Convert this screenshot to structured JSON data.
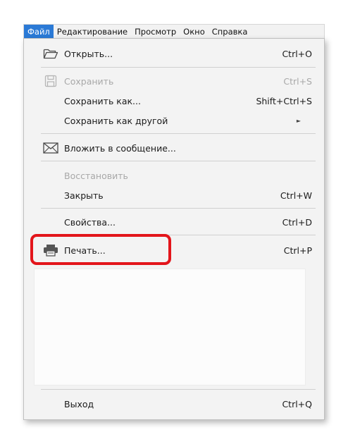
{
  "menubar": {
    "items": [
      "Файл",
      "Редактирование",
      "Просмотр",
      "Окно",
      "Справка"
    ]
  },
  "file_menu": {
    "open": {
      "label": "Открыть...",
      "shortcut": "Ctrl+O",
      "icon": "folder-open-icon"
    },
    "save": {
      "label": "Сохранить",
      "shortcut": "Ctrl+S",
      "icon": "save-icon",
      "disabled": true
    },
    "save_as": {
      "label": "Сохранить как...",
      "shortcut": "Shift+Ctrl+S"
    },
    "save_as_other": {
      "label": "Сохранить как другой",
      "submenu_arrow": "►"
    },
    "attach": {
      "label": "Вложить в сообщение...",
      "icon": "envelope-icon"
    },
    "revert": {
      "label": "Восстановить",
      "disabled": true
    },
    "close": {
      "label": "Закрыть",
      "shortcut": "Ctrl+W"
    },
    "properties": {
      "label": "Свойства...",
      "shortcut": "Ctrl+D"
    },
    "print": {
      "label": "Печать...",
      "shortcut": "Ctrl+P",
      "icon": "printer-icon"
    },
    "exit": {
      "label": "Выход",
      "shortcut": "Ctrl+Q"
    }
  },
  "colors": {
    "active_menu": "#2b7ad6",
    "highlight_annotation": "#e3151b",
    "disabled_text": "#a8a8a8"
  }
}
